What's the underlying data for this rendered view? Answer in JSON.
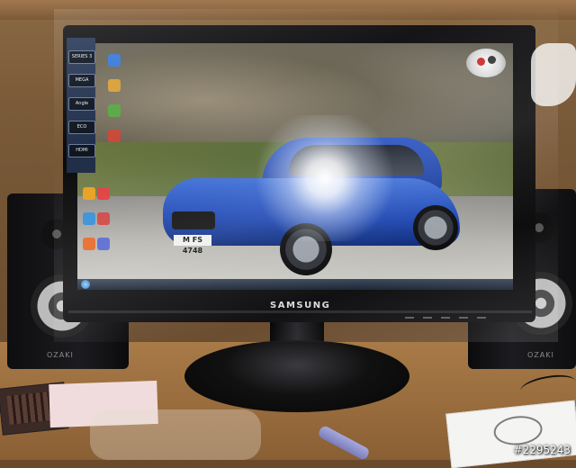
{
  "scene": {
    "colors": {
      "monitor_bezel": "#0a0a0b",
      "car_blue": "#1c46b2",
      "desk_wood": "#9a6d3e",
      "wall_wood": "#7a5a38"
    }
  },
  "monitor": {
    "brand_logo": "SAMSUNG",
    "side_badges": [
      "SERIES 3",
      "MEGA",
      "Angle",
      "ECO",
      "HDMI"
    ]
  },
  "wallpaper": {
    "license_plate": "M FS 4748"
  },
  "speakers": {
    "brand": "OZAKI"
  },
  "watermark": {
    "text": "#2295243"
  }
}
